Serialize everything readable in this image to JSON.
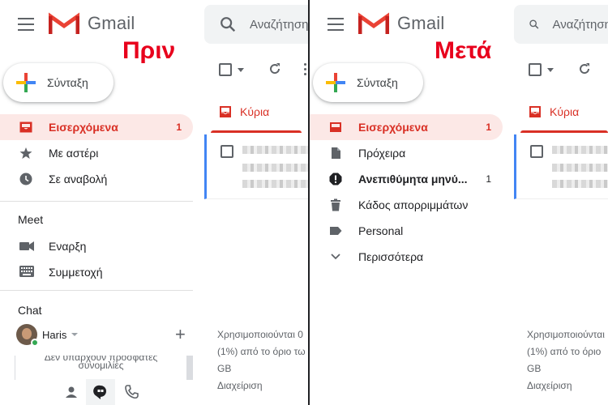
{
  "app": {
    "name": "Gmail"
  },
  "search": {
    "placeholder": "Αναζήτηση"
  },
  "labels": {
    "before": "Πριν",
    "after": "Μετά"
  },
  "compose": {
    "label": "Σύνταξη"
  },
  "colors": {
    "accent_red": "#d93025",
    "active_bg": "#fce8e6",
    "overlay_red": "#e8001c",
    "tab_blue": "#4285f4"
  },
  "before": {
    "nav": [
      {
        "label": "Εισερχόμενα",
        "count": "1",
        "icon": "inbox-icon",
        "active": true
      },
      {
        "label": "Με αστέρι",
        "count": "",
        "icon": "star-icon",
        "active": false
      },
      {
        "label": "Σε αναβολή",
        "count": "",
        "icon": "clock-icon",
        "active": false
      }
    ],
    "meet": {
      "title": "Meet",
      "items": [
        {
          "label": "Εναρξη",
          "icon": "video-icon"
        },
        {
          "label": "Συμμετοχή",
          "icon": "keyboard-icon"
        }
      ]
    },
    "chat": {
      "title": "Chat",
      "user": "Haris",
      "empty_line1": "Δεν υπάρχουν πρόσφατες",
      "empty_line2": "συνομιλίες"
    }
  },
  "after": {
    "nav": [
      {
        "label": "Εισερχόμενα",
        "count": "1",
        "icon": "inbox-icon",
        "active": true
      },
      {
        "label": "Πρόχειρα",
        "count": "",
        "icon": "draft-icon",
        "active": false
      },
      {
        "label": "Ανεπιθύμητα μηνύ...",
        "count": "1",
        "icon": "spam-icon",
        "active": false,
        "bold": true
      },
      {
        "label": "Κάδος απορριμμάτων",
        "count": "",
        "icon": "trash-icon",
        "active": false
      },
      {
        "label": "Personal",
        "count": "",
        "icon": "label-icon",
        "active": false
      },
      {
        "label": "Περισσότερα",
        "count": "",
        "icon": "chevron-down-icon",
        "active": false
      }
    ]
  },
  "mail": {
    "tab_primary": "Κύρια",
    "storage_before": [
      "Χρησιμοποιούνται 0",
      "(1%) από το όριο τω",
      "GB",
      "Διαχείριση"
    ],
    "storage_after": [
      "Χρησιμοποιούνται",
      "(1%) από το όριο",
      "GB",
      "Διαχείριση"
    ]
  }
}
